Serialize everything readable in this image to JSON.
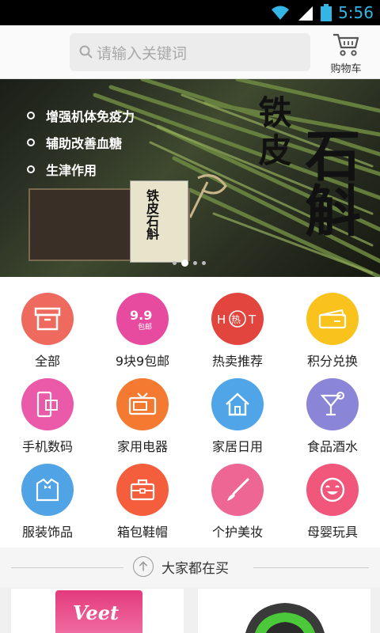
{
  "status_bar": {
    "time": "5:56"
  },
  "header": {
    "search_placeholder": "请输入关键词",
    "cart_label": "购物车"
  },
  "banner": {
    "bullets": [
      "增强机体免疫力",
      "辅助改善血糖",
      "生津作用"
    ],
    "brand_big_1": "铁皮",
    "brand_big_2": "石斛",
    "box_text": "铁皮石斛",
    "slides": 4,
    "active_slide": 2
  },
  "categories": [
    {
      "label": "全部",
      "icon": "box-icon",
      "color": "#ef6a5e"
    },
    {
      "label": "9块9包邮",
      "icon": "ninepointnine-icon",
      "color": "#e64ba0"
    },
    {
      "label": "热卖推荐",
      "icon": "hot-icon",
      "color": "#e2453d"
    },
    {
      "label": "积分兑换",
      "icon": "card-icon",
      "color": "#f9c21c"
    },
    {
      "label": "手机数码",
      "icon": "phone-icon",
      "color": "#ea5aa9"
    },
    {
      "label": "家用电器",
      "icon": "tv-icon",
      "color": "#f47a32"
    },
    {
      "label": "家居日用",
      "icon": "home-icon",
      "color": "#4fa5e8"
    },
    {
      "label": "食品酒水",
      "icon": "cocktail-icon",
      "color": "#8b85d8"
    },
    {
      "label": "服装饰品",
      "icon": "shirt-icon",
      "color": "#50a3e4"
    },
    {
      "label": "箱包鞋帽",
      "icon": "bag-icon",
      "color": "#f45e3c"
    },
    {
      "label": "个护美妆",
      "icon": "brush-icon",
      "color": "#ee6693"
    },
    {
      "label": "母婴玩具",
      "icon": "smiley-icon",
      "color": "#f0577b"
    }
  ],
  "section": {
    "title": "大家都在买"
  },
  "products": [
    {
      "brand": "Veet"
    },
    {
      "brand": ""
    }
  ]
}
